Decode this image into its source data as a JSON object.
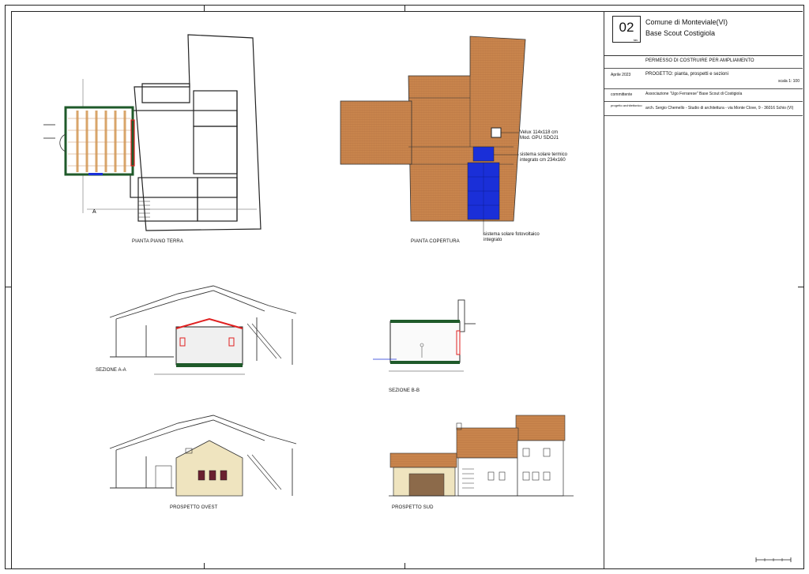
{
  "title_block": {
    "sheet_number": "02",
    "sheet_sub": "tav.",
    "municipality": "Comune di Monteviale(VI)",
    "site": "Base Scout Costigiola",
    "permit": "PERMESSO DI COSTRUIRE PER AMPLIAMENTO",
    "date_label": "Aprile 2023",
    "project_label": "PROGETTO:",
    "project_desc": "pianta, prospetti e sezioni",
    "scale": "scala 1: 100",
    "client_label": "committente",
    "client": "Associazione \"Ugo Ferrarese\" Base Scout di Costigiola",
    "designer_label": "progetto architettonico",
    "designer": "arch. Sergio Chemello - Studio di architettura - via Monte Clove, 9 - 36016 Schio (VI)"
  },
  "drawings": {
    "ground_plan": "PIANTA PIANO TERRA",
    "roof_plan": "PIANTA COPERTURA",
    "section_aa": "SEZIONE A-A",
    "section_bb": "SEZIONE B-B",
    "west": "PROSPETTO OVEST",
    "south": "PROSPETTO SUD"
  },
  "annotations": {
    "velux": "Velux 114x118 cm",
    "velux_mod": "Mod. GPU SDOJ1",
    "solar_thermal": "sistema solare termico",
    "solar_thermal_size": "integrato cm 234x160",
    "pv": "sistema solare fotovoltaico",
    "pv_sub": "integrato",
    "section_mark": "A"
  },
  "colors": {
    "roof": "#c8844c",
    "solar": "#1a2fd8",
    "wall_cream": "#efe4bf",
    "red_mark": "#e02020"
  }
}
